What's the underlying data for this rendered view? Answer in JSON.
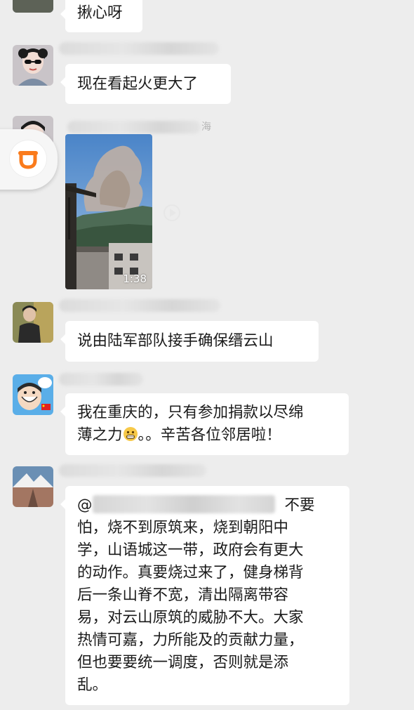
{
  "chat": {
    "message_1": {
      "text": "揪心呀"
    },
    "message_2": {
      "text": "现在看起火更大了"
    },
    "message_3": {
      "video_duration": "1:38",
      "sender_suffix": "海"
    },
    "message_4": {
      "text": "说由陆军部队接手确保缙云山"
    },
    "message_5": {
      "line_1": "我在重庆的，只有参加捐款以尽绵",
      "line_2a": "薄之力",
      "line_2b": "。。辛苦各位邻居啦！"
    },
    "message_6": {
      "mention_prefix": "@",
      "mention_suffix": "不要",
      "lines": [
        "怕，烧不到原筑来，烧到朝阳中",
        "学，山语城这一带，政府会有更大",
        "的动作。真要烧过来了，健身梯背",
        "后一条山脊不宽，清出隔离带容",
        "易，对云山原筑的威胁不大。大家",
        "热情可嘉，力所能及的贡献力量，",
        "但也要要统一调度，否则就是添",
        "乱。"
      ]
    }
  },
  "icons": {
    "floating": "didi-logo-icon",
    "play": "play-icon",
    "emoji": "grimace-emoji-icon",
    "flag": "china-flag-icon"
  },
  "colors": {
    "background": "#ededed",
    "bubble": "#ffffff",
    "didi_orange": "#fa7b1c"
  }
}
